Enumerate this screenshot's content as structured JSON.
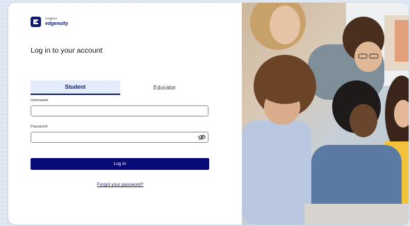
{
  "brand": {
    "line1": "imagine",
    "line2": "edgenuity",
    "logo_icon": "edgenuity-e-logo-icon"
  },
  "login": {
    "title": "Log in to your account",
    "tabs": [
      {
        "label": "Student",
        "active": true
      },
      {
        "label": "Educator",
        "active": false
      }
    ],
    "username": {
      "label": "Username",
      "value": "",
      "placeholder": ""
    },
    "password": {
      "label": "Password",
      "value": "",
      "placeholder": "",
      "toggle_icon": "eye-slash-icon"
    },
    "submit_label": "Log In",
    "forgot_link": "Forgot your password?"
  },
  "colors": {
    "brand_navy": "#0d1b6e",
    "button": "#080a76",
    "active_tab_bg": "#e4ecfb",
    "background": "#dfe8f3"
  }
}
